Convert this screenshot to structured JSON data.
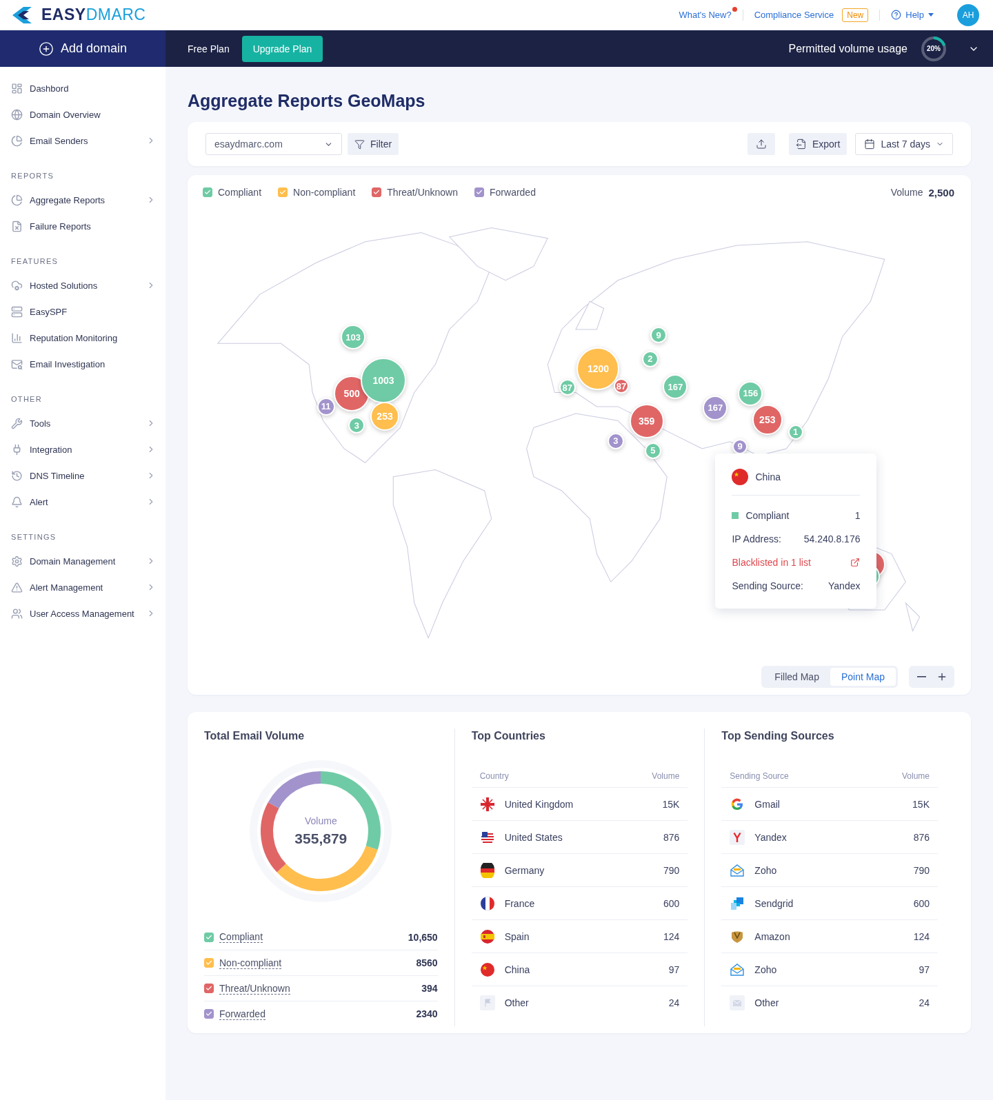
{
  "header": {
    "logo_bold": "EASY",
    "logo_light": "DMARC",
    "whats_new": "What's New?",
    "has_news": true,
    "compliance": "Compliance Service",
    "badge": "New",
    "help": "Help",
    "avatar": "AH"
  },
  "topbar": {
    "add_domain": "Add domain",
    "plan": "Free Plan",
    "upgrade": "Upgrade Plan",
    "usage_label": "Permitted volume usage",
    "usage": {
      "reading": "20%",
      "level": 0.2
    }
  },
  "sidebar": {
    "sections": [
      {
        "items": [
          {
            "label": "Dashbord",
            "expandable": false,
            "selected": false
          },
          {
            "label": "Domain Overview",
            "expandable": false,
            "selected": false
          },
          {
            "label": "Email Senders",
            "expandable": true,
            "selected": false
          }
        ]
      },
      {
        "heading": "REPORTS",
        "items": [
          {
            "label": "Aggregate Reports",
            "expandable": true,
            "selected": false
          },
          {
            "label": "Failure Reports",
            "expandable": false,
            "selected": false
          }
        ]
      },
      {
        "heading": "FEATURES",
        "items": [
          {
            "label": "Hosted Solutions",
            "expandable": true,
            "selected": false
          },
          {
            "label": "EasySPF",
            "expandable": false,
            "selected": false
          },
          {
            "label": "Reputation Monitoring",
            "expandable": false,
            "selected": false
          },
          {
            "label": "Email Investigation",
            "expandable": false,
            "selected": false
          }
        ]
      },
      {
        "heading": "OTHER",
        "items": [
          {
            "label": "Tools",
            "expandable": true,
            "selected": false
          },
          {
            "label": "Integration",
            "expandable": true,
            "selected": false
          },
          {
            "label": "DNS Timeline",
            "expandable": true,
            "selected": false
          },
          {
            "label": "Alert",
            "expandable": true,
            "selected": false
          }
        ]
      },
      {
        "heading": "SETTINGS",
        "items": [
          {
            "label": "Domain Management",
            "expandable": true,
            "selected": false
          },
          {
            "label": "Alert Management",
            "expandable": true,
            "selected": false
          },
          {
            "label": "User Access Management",
            "expandable": true,
            "selected": false
          }
        ]
      }
    ]
  },
  "page_title": "Aggregate Reports GeoMaps",
  "toolbar": {
    "domain": "esaydmarc.com",
    "filter": "Filter",
    "export": "Export",
    "date_range": "Last 7 days"
  },
  "map": {
    "legend": [
      {
        "label": "Compliant",
        "checked": true,
        "color": "#6fcba5"
      },
      {
        "label": "Non-compliant",
        "checked": true,
        "color": "#ffbe4d"
      },
      {
        "label": "Threat/Unknown",
        "checked": true,
        "color": "#e06666"
      },
      {
        "label": "Forwarded",
        "checked": true,
        "color": "#a293cc"
      }
    ],
    "volume_label": "Volume",
    "volume": "2,500",
    "bubbles": [
      {
        "label": "103",
        "color": "#6fcba5"
      },
      {
        "label": "500",
        "color": "#e06666"
      },
      {
        "label": "1003",
        "color": "#6fcba5"
      },
      {
        "label": "11",
        "color": "#a293cc"
      },
      {
        "label": "253",
        "color": "#ffbe4d"
      },
      {
        "label": "3",
        "color": "#6fcba5"
      },
      {
        "label": "1200",
        "color": "#ffbe4d"
      },
      {
        "label": "87",
        "color": "#6fcba5"
      },
      {
        "label": "87",
        "color": "#e06666"
      },
      {
        "label": "9",
        "color": "#6fcba5"
      },
      {
        "label": "2",
        "color": "#6fcba5"
      },
      {
        "label": "167",
        "color": "#6fcba5"
      },
      {
        "label": "167",
        "color": "#a293cc"
      },
      {
        "label": "156",
        "color": "#6fcba5"
      },
      {
        "label": "359",
        "color": "#e06666"
      },
      {
        "label": "253",
        "color": "#e06666"
      },
      {
        "label": "1",
        "color": "#6fcba5"
      },
      {
        "label": "3",
        "color": "#a293cc"
      },
      {
        "label": "5",
        "color": "#6fcba5"
      },
      {
        "label": "9",
        "color": "#a293cc"
      },
      {
        "color": "#e06666"
      },
      {
        "color": "#6fcba5"
      }
    ],
    "tooltip": {
      "country": "China",
      "status_label": "Compliant",
      "status_value": "1",
      "ip_label": "IP Address:",
      "ip": "54.240.8.176",
      "blacklist": "Blacklisted in 1 list",
      "source_label": "Sending Source:",
      "source": "Yandex"
    },
    "view_modes": [
      {
        "label": "Filled Map",
        "selected": false
      },
      {
        "label": "Point Map",
        "selected": true
      }
    ]
  },
  "volume": {
    "title": "Total Email Volume",
    "center_label": "Volume",
    "center_value": "355,879",
    "legend": [
      {
        "label": "Compliant",
        "value": "10,650",
        "color": "#6fcba5",
        "checked": true
      },
      {
        "label": "Non-compliant",
        "value": "8560",
        "color": "#ffbe4d",
        "checked": true
      },
      {
        "label": "Threat/Unknown",
        "value": "394",
        "color": "#e06666",
        "checked": true
      },
      {
        "label": "Forwarded",
        "value": "2340",
        "color": "#a293cc",
        "checked": true
      }
    ]
  },
  "countries": {
    "title": "Top Countries",
    "columns": [
      "Country",
      "Volume"
    ],
    "rows": [
      {
        "name": "United Kingdom",
        "volume": "15K"
      },
      {
        "name": "United States",
        "volume": "876"
      },
      {
        "name": "Germany",
        "volume": "790"
      },
      {
        "name": "France",
        "volume": "600"
      },
      {
        "name": "Spain",
        "volume": "124"
      },
      {
        "name": "China",
        "volume": "97"
      },
      {
        "name": "Other",
        "volume": "24"
      }
    ]
  },
  "sources": {
    "title": "Top Sending Sources",
    "columns": [
      "Sending Source",
      "Volume"
    ],
    "rows": [
      {
        "name": "Gmail",
        "volume": "15K"
      },
      {
        "name": "Yandex",
        "volume": "876"
      },
      {
        "name": "Zoho",
        "volume": "790"
      },
      {
        "name": "Sendgrid",
        "volume": "600"
      },
      {
        "name": "Amazon",
        "volume": "124"
      },
      {
        "name": "Zoho",
        "volume": "97"
      },
      {
        "name": "Other",
        "volume": "24"
      }
    ]
  }
}
